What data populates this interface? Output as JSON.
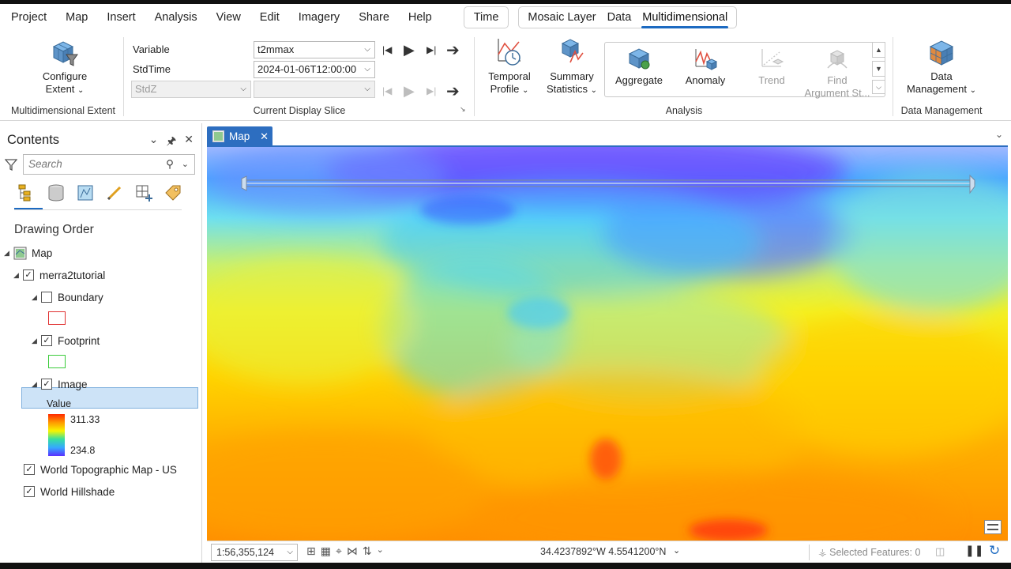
{
  "menubar": {
    "items": [
      "Project",
      "Map",
      "Insert",
      "Analysis",
      "View",
      "Edit",
      "Imagery",
      "Share",
      "Help"
    ],
    "time_tab": "Time",
    "context_tabs": [
      "Mosaic Layer",
      "Data",
      "Multidimensional"
    ]
  },
  "ribbon": {
    "extent": {
      "button": [
        "Configure",
        "Extent"
      ],
      "group_label": "Multidimensional Extent"
    },
    "slice": {
      "variable_label": "Variable",
      "variable_value": "t2mmax",
      "stdtime_label": "StdTime",
      "stdtime_value": "2024-01-06T12:00:00",
      "stdz_value": "StdZ",
      "group_label": "Current Display Slice"
    },
    "analysis": {
      "temporal_profile": [
        "Temporal",
        "Profile"
      ],
      "summary_statistics": [
        "Summary",
        "Statistics"
      ],
      "gallery": [
        {
          "label": [
            "Aggregate",
            ""
          ],
          "enabled": true
        },
        {
          "label": [
            "Anomaly",
            ""
          ],
          "enabled": true
        },
        {
          "label": [
            "Trend",
            ""
          ],
          "enabled": false
        },
        {
          "label": [
            "Find",
            "Argument St..."
          ],
          "enabled": false
        }
      ],
      "group_label": "Analysis"
    },
    "data_management": {
      "button": [
        "Data",
        "Management"
      ],
      "group_label": "Data Management"
    }
  },
  "contents": {
    "title": "Contents",
    "search_placeholder": "Search",
    "drawing_order": "Drawing Order",
    "map_node": "Map",
    "layer": "merra2tutorial",
    "sublayers": [
      "Boundary",
      "Footprint",
      "Image"
    ],
    "value_label": "Value",
    "legend_max": "311.33",
    "legend_min": "234.8",
    "basemaps": [
      "World Topographic Map - US",
      "World Hillshade"
    ],
    "colors": {
      "boundary": "#e03030",
      "footprint": "#3ccc3c",
      "accent": "#1c6ac1"
    }
  },
  "map_view": {
    "tab_label": "Map",
    "scale": "1:56,355,124",
    "coordinates": "34.4237892°W 4.5541200°N",
    "selected_features": "Selected Features: 0"
  }
}
